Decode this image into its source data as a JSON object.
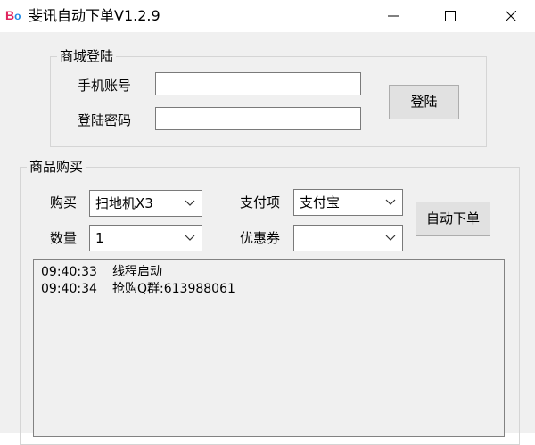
{
  "window": {
    "title": "斐讯自动下单V1.2.9",
    "icon_text_b": "B",
    "icon_text_o": "o"
  },
  "login": {
    "group_title": "商城登陆",
    "phone_label": "手机账号",
    "phone_value": "",
    "password_label": "登陆密码",
    "password_value": "",
    "login_button": "登陆"
  },
  "purchase": {
    "group_title": "商品购买",
    "buy_label": "购买",
    "buy_selected": "扫地机X3",
    "quantity_label": "数量",
    "quantity_selected": "1",
    "payment_label": "支付项",
    "payment_selected": "支付宝",
    "coupon_label": "优惠券",
    "coupon_selected": "",
    "auto_order_button": "自动下单"
  },
  "log": [
    {
      "time": "09:40:33",
      "message": "线程启动"
    },
    {
      "time": "09:40:34",
      "message": "抢购Q群:613988061"
    }
  ],
  "icons": {
    "minimize": "minimize-icon",
    "maximize": "maximize-icon",
    "close": "close-icon",
    "dropdown": "chevron-down-icon"
  }
}
